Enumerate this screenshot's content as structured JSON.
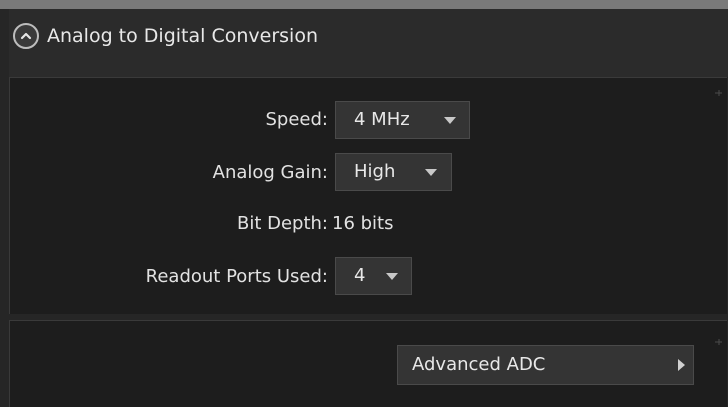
{
  "panel": {
    "title": "Analog to Digital Conversion"
  },
  "settings": {
    "speed_label": "Speed:",
    "speed_value": "4 MHz",
    "gain_label": "Analog Gain:",
    "gain_value": "High",
    "bit_depth_label": "Bit Depth:",
    "bit_depth_value": "16 bits",
    "ports_label": "Readout Ports Used:",
    "ports_value": "4"
  },
  "advanced": {
    "button_label": "Advanced ADC"
  },
  "icons": {
    "collapse": "chevron-up-icon",
    "dropdown": "caret-down-icon",
    "expand": "caret-right-icon",
    "pin": "pin-icon"
  },
  "colors": {
    "background": "#262626",
    "group_background": "#1d1d1d",
    "control_background": "#343434",
    "text": "#e2e2e2"
  }
}
